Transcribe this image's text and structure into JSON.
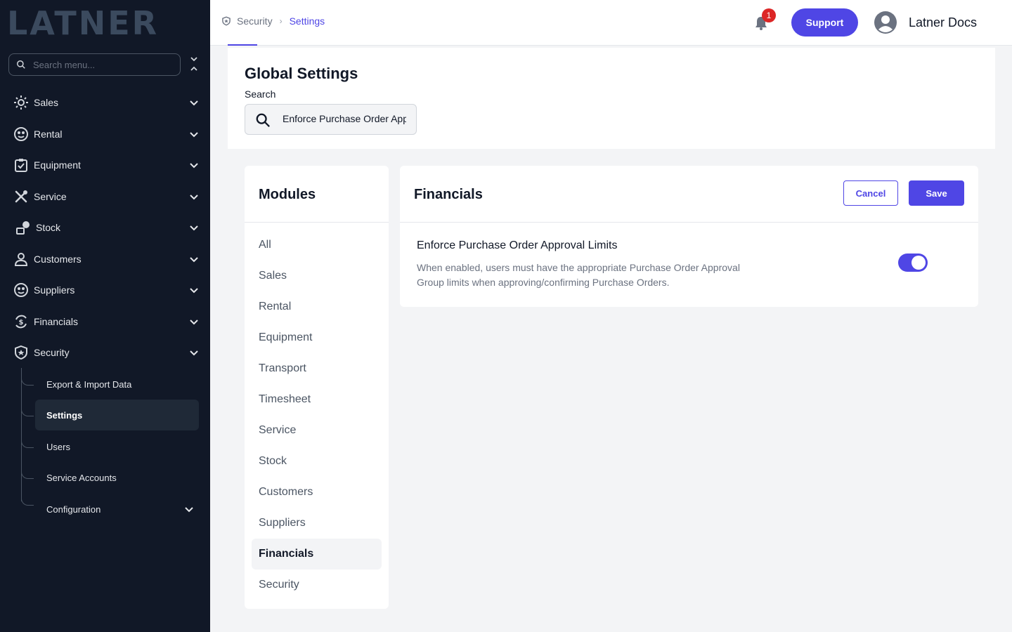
{
  "brand": {
    "logo_text": "LATNER"
  },
  "sidebar": {
    "search_placeholder": "Search menu...",
    "items": [
      {
        "label": "Sales",
        "icon": "sales-icon"
      },
      {
        "label": "Rental",
        "icon": "rental-icon"
      },
      {
        "label": "Equipment",
        "icon": "equipment-icon"
      },
      {
        "label": "Service",
        "icon": "service-icon"
      },
      {
        "label": "Stock",
        "icon": "stock-icon"
      },
      {
        "label": "Customers",
        "icon": "customers-icon"
      },
      {
        "label": "Suppliers",
        "icon": "suppliers-icon"
      },
      {
        "label": "Financials",
        "icon": "financials-icon"
      },
      {
        "label": "Security",
        "icon": "security-icon"
      }
    ],
    "security_children": [
      {
        "label": "Export & Import Data"
      },
      {
        "label": "Settings",
        "active": true
      },
      {
        "label": "Users"
      },
      {
        "label": "Service Accounts"
      },
      {
        "label": "Configuration"
      }
    ]
  },
  "header": {
    "breadcrumb": {
      "parent": "Security",
      "current": "Settings"
    },
    "notifications_count": "1",
    "support_label": "Support",
    "user_name": "Latner Docs"
  },
  "global_settings": {
    "title": "Global Settings",
    "search_label": "Search",
    "search_value": "Enforce Purchase Order Approval Limits"
  },
  "modules": {
    "title": "Modules",
    "items": [
      "All",
      "Sales",
      "Rental",
      "Equipment",
      "Transport",
      "Timesheet",
      "Service",
      "Stock",
      "Customers",
      "Suppliers",
      "Financials",
      "Security"
    ],
    "active": "Financials"
  },
  "financials": {
    "title": "Financials",
    "cancel_label": "Cancel",
    "save_label": "Save",
    "setting": {
      "title": "Enforce Purchase Order Approval Limits",
      "description": "When enabled, users must have the appropriate Purchase Order Approval Group limits when approving/confirming Purchase Orders.",
      "enabled": true
    }
  },
  "colors": {
    "accent": "#4f46e5",
    "sidebar_bg": "#111827",
    "badge": "#dc2626"
  }
}
